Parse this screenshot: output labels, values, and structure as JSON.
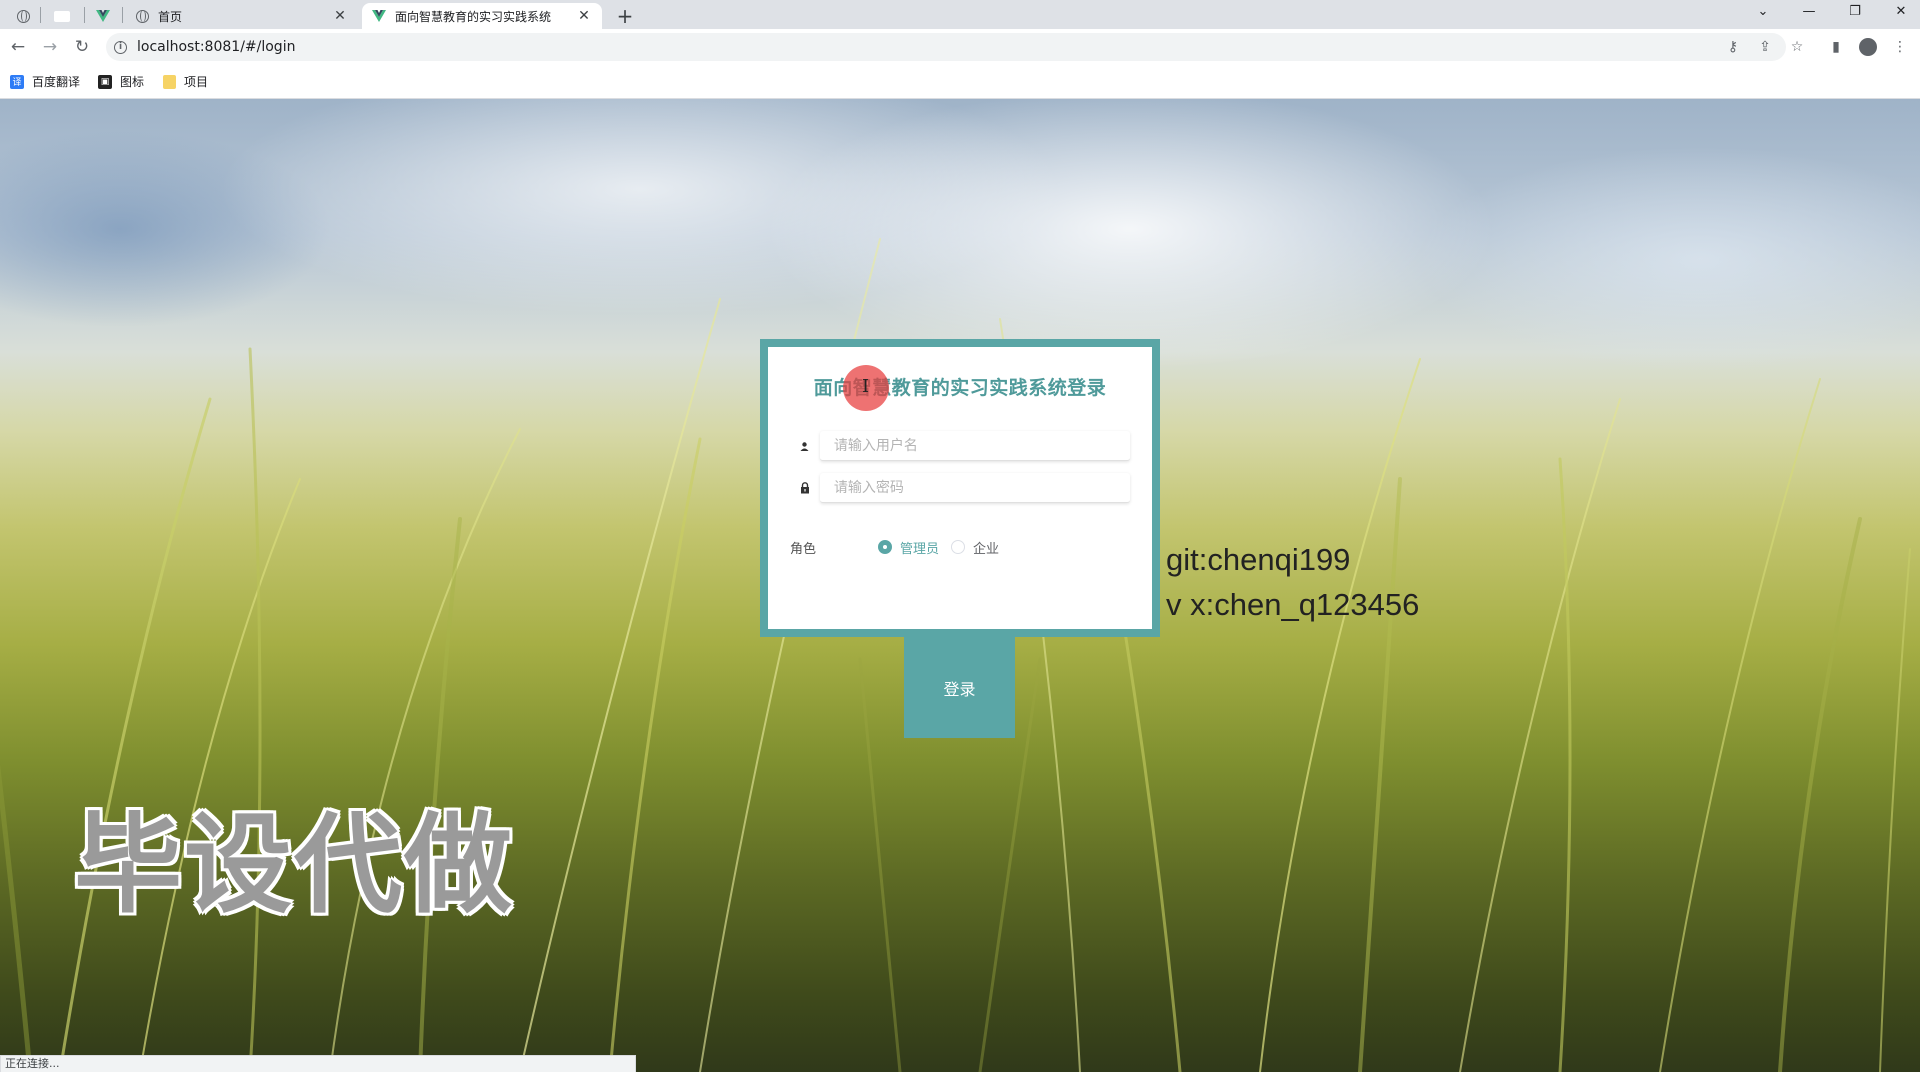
{
  "browser": {
    "tabs": [
      {
        "title": "首页",
        "close": "✕"
      },
      {
        "title": "面向智慧教育的实习实践系统",
        "close": "✕"
      }
    ],
    "new_tab": "+",
    "window_controls": {
      "dropdown": "⌄",
      "minimize": "—",
      "restore": "❐",
      "close": "✕"
    },
    "url": "localhost:8081/#/login",
    "bookmarks": [
      {
        "label": "百度翻译",
        "icon": "baidu-translate-icon",
        "icon_text": "译"
      },
      {
        "label": "图标",
        "icon": "iconfont-icon"
      },
      {
        "label": "项目",
        "icon": "folder-icon"
      }
    ]
  },
  "login": {
    "title": "面向智慧教育的实习实践系统登录",
    "username_placeholder": "请输入用户名",
    "password_placeholder": "请输入密码",
    "role_label": "角色",
    "roles": [
      {
        "label": "管理员",
        "checked": true
      },
      {
        "label": "企业",
        "checked": false
      }
    ],
    "submit_label": "登录"
  },
  "overlay": {
    "git": "git:chenqi199",
    "wx": "v x:chen_q123456",
    "watermark": "毕设代做"
  },
  "status_text": "正在连接...",
  "colors": {
    "accent": "#5aa6a6",
    "title": "#4f9a9a"
  }
}
